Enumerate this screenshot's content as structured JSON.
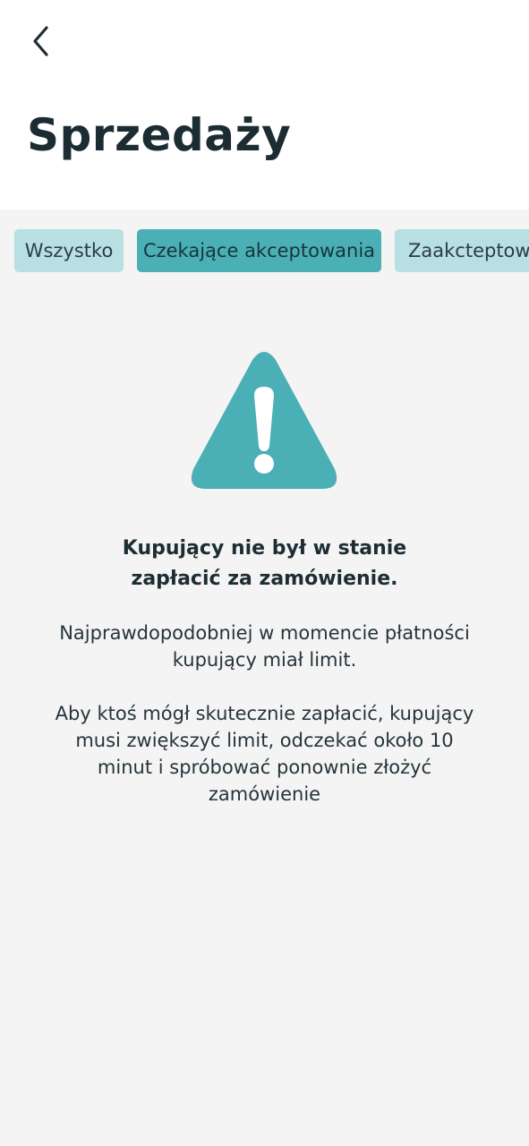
{
  "header": {
    "back_icon": "chevron-left-icon",
    "title": "Sprzedaży"
  },
  "tabs": [
    {
      "label": "Wszystko",
      "active": false
    },
    {
      "label": "Czekające akceptowania",
      "active": true
    },
    {
      "label": "Zaakcteptowane",
      "active": false
    }
  ],
  "alert": {
    "icon": "warning-icon",
    "title_lines": [
      "Kupujący nie był w stanie",
      "zapłacić za zamówienie."
    ],
    "paragraph1_lines": [
      "Najprawdopodobniej w momencie płatności",
      "kupujący miał limit."
    ],
    "paragraph2_lines": [
      "Aby ktoś mógł skutecznie zapłacić, kupujący",
      "musi zwiększyć limit, odczekać około 10",
      "minut i spróbować ponownie złożyć",
      "zamówienie"
    ]
  },
  "colors": {
    "accent": "#4bafb6",
    "tab_inactive": "#b8dfe2",
    "background": "#f4f4f4",
    "header_background": "#ffffff",
    "text": "#1c2c33"
  }
}
